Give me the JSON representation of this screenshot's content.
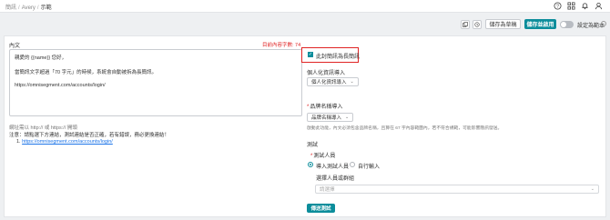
{
  "breadcrumb": {
    "items": [
      "簡訊",
      "Avery",
      "示範"
    ]
  },
  "top_icons": [
    "help-icon",
    "grid-icon",
    "bell-icon",
    "user-icon"
  ],
  "toolbar": {
    "draft_label": "儲存為草稿",
    "save_label": "儲存並啟用",
    "toggle_label": "設定為範本",
    "toggle_on": false
  },
  "editor": {
    "label": "內文",
    "counter": "目前內容字數: 74",
    "lines": [
      "親愛的 {{name}} 您好，",
      "",
      "當簡訊文字超過「70 字元」的時候，系統會自動被拆為長簡訊。",
      "",
      "https://omnisegment.com/accounts/login/"
    ]
  },
  "links": {
    "note": "網址需以 http:// 或 https:// 開頭",
    "instruction": "注意：請點選下方連結，測試連結是否正確，若有錯誤，務必更換連結！",
    "items": [
      {
        "index": "1.",
        "url": "https://omnisegment.com/accounts/login/"
      }
    ]
  },
  "long_sms": {
    "label": "此封簡訊為長簡訊",
    "checked": true
  },
  "personal": {
    "label": "個人化資訊導入",
    "dropdown": "個人化資訊導入"
  },
  "brand": {
    "label": "品牌名稱導入",
    "dropdown": "品牌名稱導入",
    "hint": "啟動此功能，內文必須包含品牌名稱，且算在 67 字內容範圍內，若不符合規範，可能影響簡訊發送。"
  },
  "test": {
    "section_label": "測試",
    "recipient_label": "測試人員",
    "option_import": "導入測試人員",
    "option_manual": "自行輸入",
    "selected": "import",
    "group_label": "選擇人員或群組",
    "group_placeholder": "請選擇",
    "send_label": "傳送測試"
  }
}
